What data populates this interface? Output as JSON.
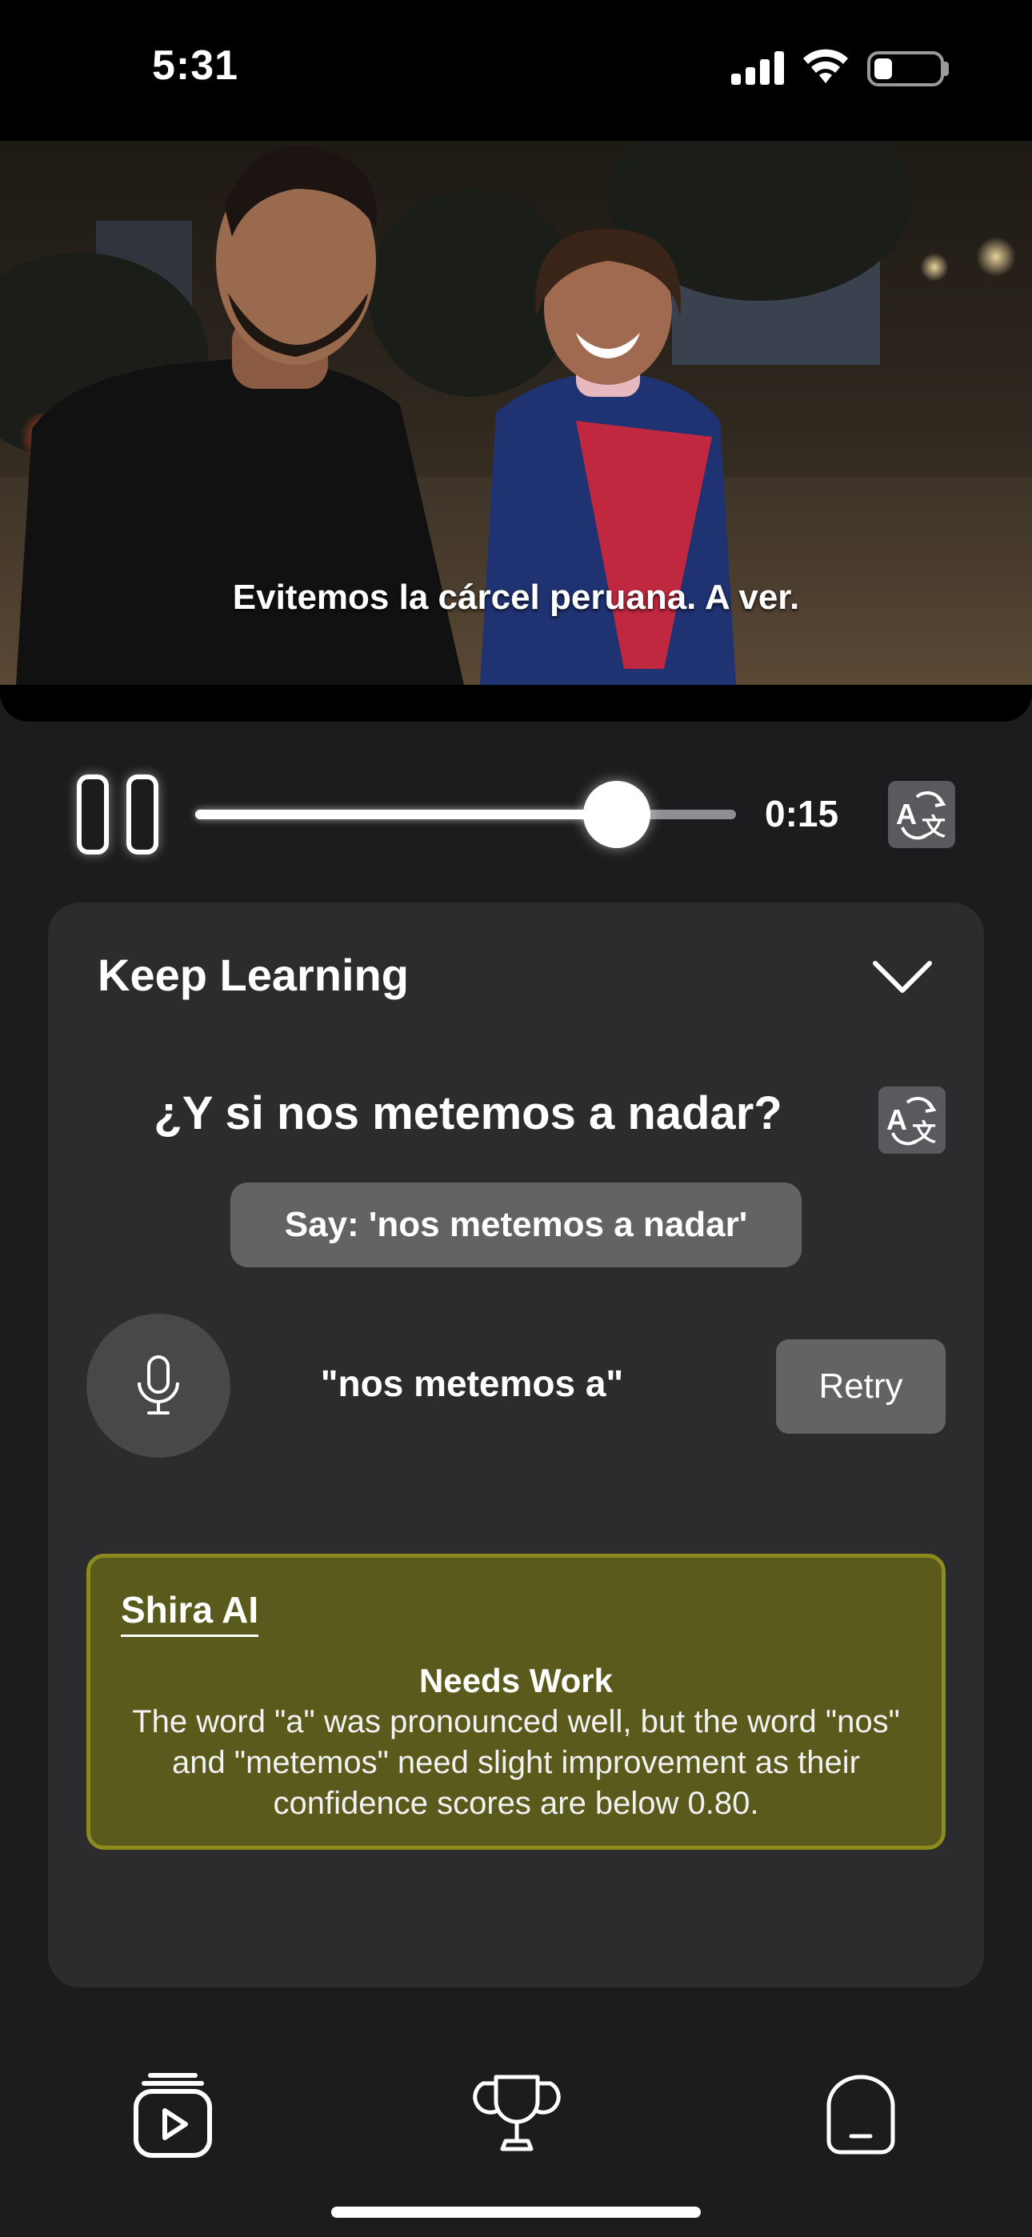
{
  "status_bar": {
    "time": "5:31",
    "icons": [
      "signal-icon",
      "wifi-icon",
      "battery-icon"
    ]
  },
  "video": {
    "caption": "Evitemos la cárcel peruana. A ver."
  },
  "player": {
    "elapsed": "0:15",
    "progress_fraction": 0.78,
    "pause_icon": "pause-icon",
    "translate_icon": "translate-icon"
  },
  "learning_card": {
    "title": "Keep Learning",
    "collapse_icon": "chevron-down-icon",
    "sentence": "¿Y si nos metemos a nadar?",
    "say_prompt": "Say: 'nos metemos a nadar'",
    "transcript": "\"nos metemos a\"",
    "retry_label": "Retry",
    "mic_icon": "microphone-icon"
  },
  "feedback": {
    "author": "Shira AI",
    "status": "Needs Work",
    "body": "The word \"a\" was pronounced well, but the word \"nos\" and \"metemos\" need slight improvement as their confidence scores are below 0.80.",
    "colors": {
      "background": "#5a5a1c",
      "border": "#8c8c1e"
    }
  },
  "tab_bar": {
    "tabs": [
      {
        "icon": "video-stack-icon",
        "active": true
      },
      {
        "icon": "trophy-icon",
        "active": false
      },
      {
        "icon": "profile-icon",
        "active": false
      }
    ]
  }
}
